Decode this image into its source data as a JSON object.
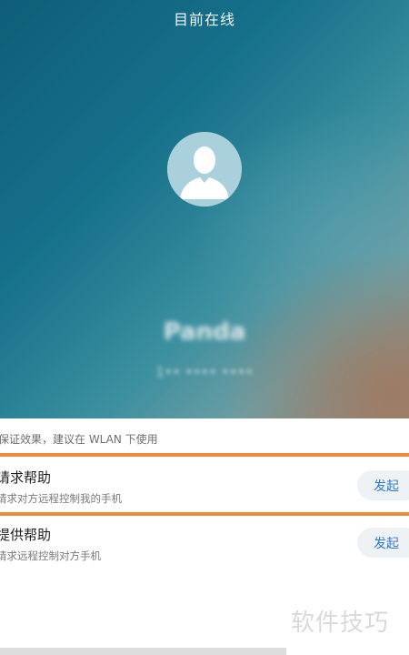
{
  "header": {
    "title": "目前在线"
  },
  "contact": {
    "name": "Panda",
    "id": "1•• •••• ••••"
  },
  "tip": {
    "text": "保证效果，建议在 WLAN 下使用"
  },
  "options": [
    {
      "title": "请求帮助",
      "subtitle": "请求对方远程控制我的手机",
      "button_label": "发起"
    },
    {
      "title": "提供帮助",
      "subtitle": "请求远程控制对方手机",
      "button_label": "发起"
    }
  ],
  "watermark": "软件技巧",
  "colors": {
    "accent_orange": "#f08a3e",
    "button_text": "#2a7bd4",
    "hero_start": "#0f5d78",
    "hero_end": "#9a8a7c"
  },
  "icons": {
    "avatar": "person-silhouette-icon"
  }
}
